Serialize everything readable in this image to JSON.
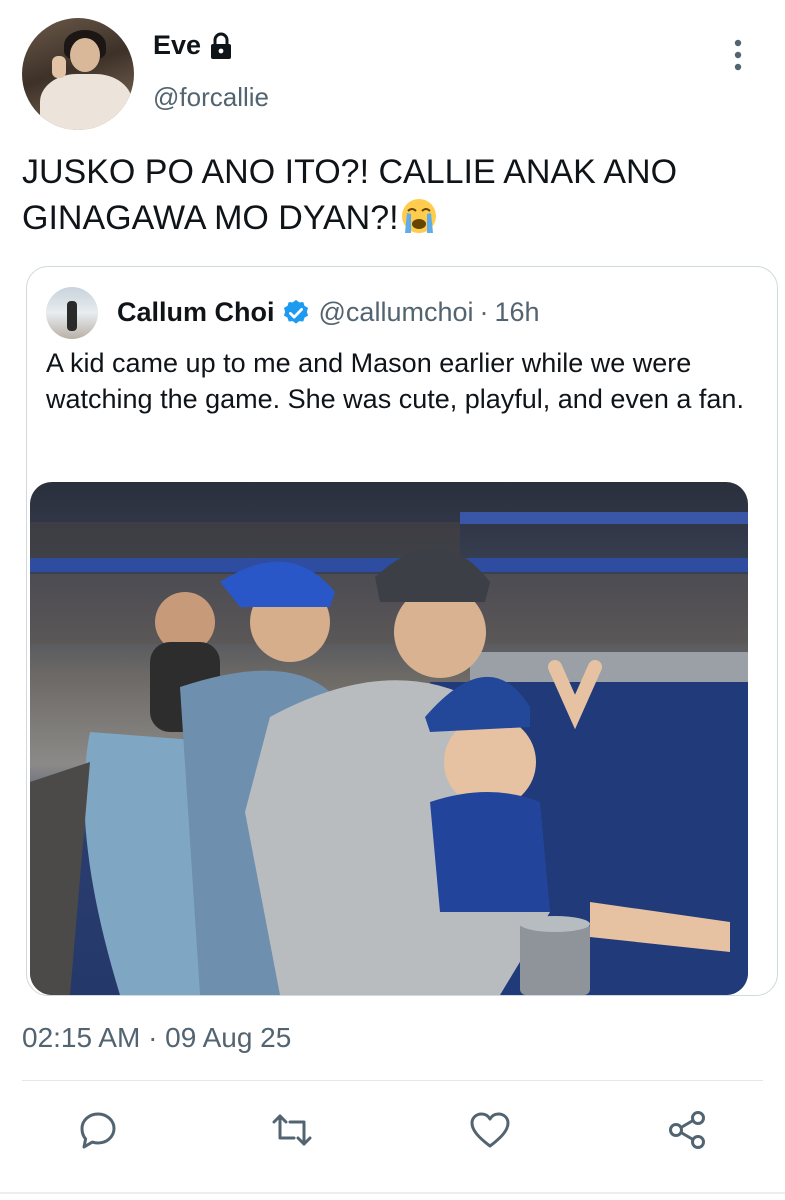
{
  "author": {
    "name": "Eve",
    "handle": "@forcallie",
    "protected_icon": "lock-icon"
  },
  "tweet": {
    "text": "JUSKO PO ANO ITO?! CALLIE ANAK ANO GINAGAWA MO DYAN?!",
    "emoji": "loudly-crying-face"
  },
  "quoted": {
    "name": "Callum Choi",
    "verified_icon": "verified-badge-icon",
    "handle": "@callumchoi",
    "separator": "·",
    "age": "16h",
    "text": "A kid came up to me and Mason earlier while we were watching the game. She was cute, playful, and even a fan.",
    "photo_description": "photo"
  },
  "timestamp": "02:15 AM · 09 Aug 25",
  "actions": [
    "reply-icon",
    "retweet-icon",
    "like-icon",
    "share-icon"
  ],
  "colors": {
    "text": "#0f1419",
    "secondary": "#536471",
    "verified": "#1d9bf0",
    "border": "#cfd9de"
  }
}
